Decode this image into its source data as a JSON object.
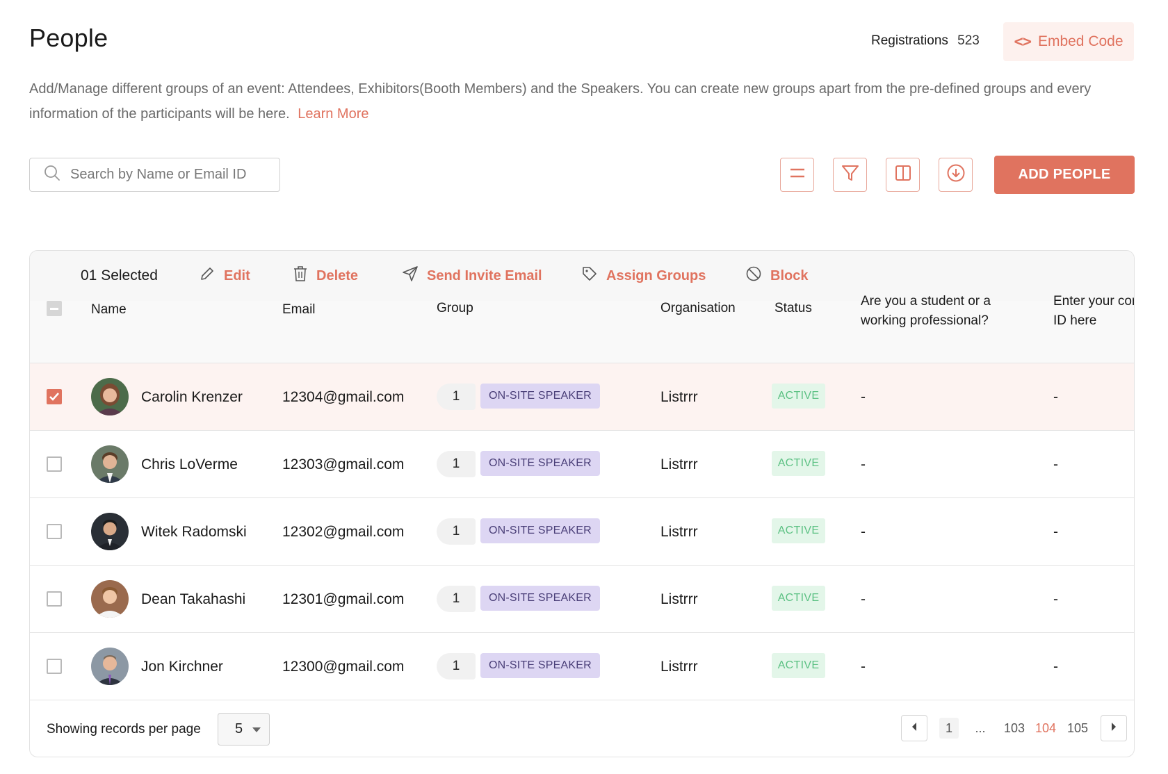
{
  "header": {
    "title": "People",
    "registrations_label": "Registrations",
    "registrations_count": "523",
    "embed_label": "Embed Code"
  },
  "description": {
    "text": "Add/Manage different groups of an event: Attendees, Exhibitors(Booth Members) and the Speakers. You can create new groups apart from the pre-defined groups and every information of the participants will be here.",
    "link": "Learn More"
  },
  "toolbar": {
    "search_placeholder": "Search by Name or Email ID",
    "add_label": "ADD PEOPLE",
    "icons": [
      "menu-icon",
      "filter-icon",
      "columns-icon",
      "download-icon"
    ]
  },
  "bulk": {
    "selected": "01 Selected",
    "edit": "Edit",
    "delete": "Delete",
    "invite": "Send Invite Email",
    "assign": "Assign Groups",
    "block": "Block"
  },
  "columns": {
    "name": "Name",
    "email": "Email",
    "group": "Group",
    "organisation": "Organisation",
    "status": "Status",
    "working_line1": "Are you a student or a",
    "working_line2": "working professional?",
    "id_line1": "Enter your company",
    "id_line2": "ID here"
  },
  "rows": [
    {
      "name": "Carolin Krenzer",
      "email": "12304@gmail.com",
      "group_count": "1",
      "group": "ON-SITE SPEAKER",
      "org": "Listrrr",
      "status": "ACTIVE",
      "working": "-",
      "id": "-",
      "selected": true
    },
    {
      "name": "Chris LoVerme",
      "email": "12303@gmail.com",
      "group_count": "1",
      "group": "ON-SITE SPEAKER",
      "org": "Listrrr",
      "status": "ACTIVE",
      "working": "-",
      "id": "-",
      "selected": false
    },
    {
      "name": "Witek Radomski",
      "email": "12302@gmail.com",
      "group_count": "1",
      "group": "ON-SITE SPEAKER",
      "org": "Listrrr",
      "status": "ACTIVE",
      "working": "-",
      "id": "-",
      "selected": false
    },
    {
      "name": "Dean Takahashi",
      "email": "12301@gmail.com",
      "group_count": "1",
      "group": "ON-SITE SPEAKER",
      "org": "Listrrr",
      "status": "ACTIVE",
      "working": "-",
      "id": "-",
      "selected": false
    },
    {
      "name": "Jon Kirchner",
      "email": "12300@gmail.com",
      "group_count": "1",
      "group": "ON-SITE SPEAKER",
      "org": "Listrrr",
      "status": "ACTIVE",
      "working": "-",
      "id": "-",
      "selected": false
    }
  ],
  "footer": {
    "records_label": "Showing records per page",
    "per_page": "5",
    "pages": {
      "first": "1",
      "ellipsis": "...",
      "p103": "103",
      "p104": "104",
      "p105": "105"
    }
  },
  "colors": {
    "accent": "#e0735f",
    "group_tag_bg": "#ddd6f3",
    "status_bg": "#e3f6e9",
    "status_text": "#5cc183"
  }
}
